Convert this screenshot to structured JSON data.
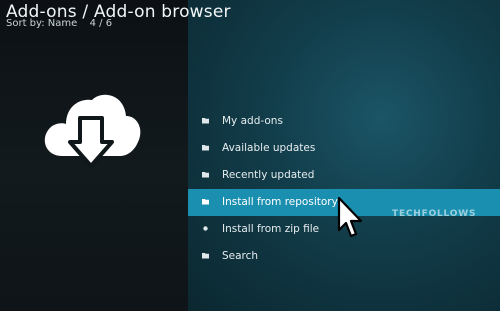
{
  "header": {
    "title": "Add-ons / Add-on browser",
    "sort_label": "Sort by: Name",
    "position": "4 / 6"
  },
  "left_panel": {
    "icon": "cloud-download-icon"
  },
  "menu": {
    "selected_index": 3,
    "items": [
      {
        "label": "My add-ons",
        "icon": "folder-icon"
      },
      {
        "label": "Available updates",
        "icon": "folder-icon"
      },
      {
        "label": "Recently updated",
        "icon": "folder-icon"
      },
      {
        "label": "Install from repository",
        "icon": "folder-icon"
      },
      {
        "label": "Install from zip file",
        "icon": "dot-icon"
      },
      {
        "label": "Search",
        "icon": "folder-icon"
      }
    ]
  },
  "watermark": {
    "text": "TECHFOLLOWS"
  },
  "colors": {
    "selected": "#1a8fb0",
    "panel": "#123d4a"
  }
}
